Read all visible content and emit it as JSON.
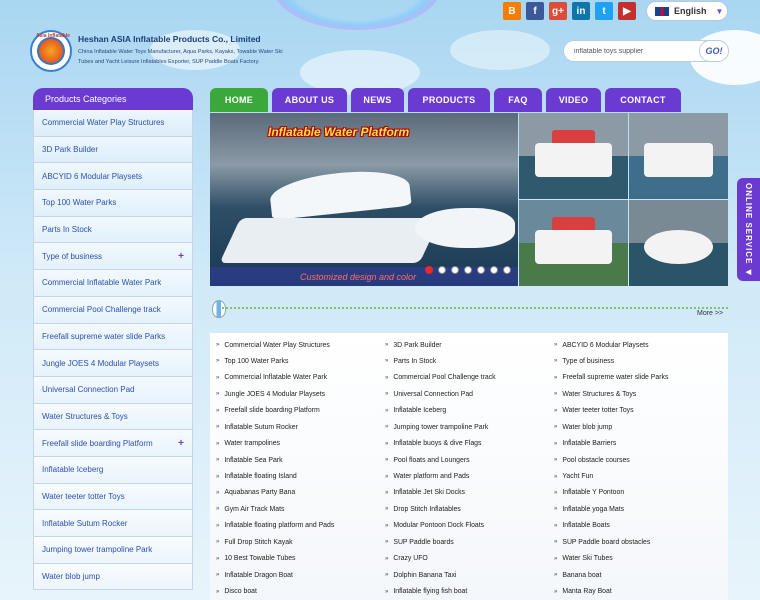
{
  "header": {
    "logo_tag": "Asia Inflatable",
    "company_name": "Heshan ASIA Inflatable Products Co., Limited",
    "company_sub": "China Inflatable Water Toys Manufacturer, Aqua Parks, Kayaks, Towable Water Ski Tubes and Yacht Leisure Inflatables Exporter, SUP Paddle Boats Factory.",
    "social": [
      {
        "name": "blogger-icon",
        "glyph": "B",
        "color": "#f57d00"
      },
      {
        "name": "facebook-icon",
        "glyph": "f",
        "color": "#3b5998"
      },
      {
        "name": "google-plus-icon",
        "glyph": "g+",
        "color": "#dd4b39"
      },
      {
        "name": "linkedin-icon",
        "glyph": "in",
        "color": "#0e76a8"
      },
      {
        "name": "twitter-icon",
        "glyph": "t",
        "color": "#1da1f2"
      },
      {
        "name": "youtube-icon",
        "glyph": "▶",
        "color": "#c4302b"
      }
    ],
    "language": "English",
    "search_value": "inflatable toys supplier",
    "search_button": "GO!"
  },
  "sidebar": {
    "title": "Products Categories",
    "items": [
      {
        "label": "Commercial Water Play Structures",
        "expand": ""
      },
      {
        "label": "3D Park Builder",
        "expand": ""
      },
      {
        "label": "ABCYID 6 Modular Playsets",
        "expand": ""
      },
      {
        "label": "Top 100 Water Parks",
        "expand": ""
      },
      {
        "label": "Parts In Stock",
        "expand": ""
      },
      {
        "label": "Type of business",
        "expand": "+"
      },
      {
        "label": "Commercial Inflatable Water Park",
        "expand": ""
      },
      {
        "label": "Commercial Pool Challenge track",
        "expand": ""
      },
      {
        "label": "Freefall supreme water slide Parks",
        "expand": ""
      },
      {
        "label": "Jungle JOES 4 Modular Playsets",
        "expand": ""
      },
      {
        "label": "Universal Connection Pad",
        "expand": ""
      },
      {
        "label": "Water Structures & Toys",
        "expand": ""
      },
      {
        "label": "Freefall slide boarding Platform",
        "expand": "+"
      },
      {
        "label": "Inflatable Iceberg",
        "expand": ""
      },
      {
        "label": "Water teeter totter Toys",
        "expand": ""
      },
      {
        "label": "Inflatable Sutum Rocker",
        "expand": ""
      },
      {
        "label": "Jumping tower trampoline Park",
        "expand": ""
      },
      {
        "label": "Water blob jump",
        "expand": ""
      }
    ]
  },
  "nav": [
    {
      "label": "HOME",
      "active": true,
      "width": 58
    },
    {
      "label": "ABOUT US",
      "active": false,
      "width": 75
    },
    {
      "label": "NEWS",
      "active": false,
      "width": 53
    },
    {
      "label": "PRODUCTS",
      "active": false,
      "width": 82
    },
    {
      "label": "FAQ",
      "active": false,
      "width": 48
    },
    {
      "label": "VIDEO",
      "active": false,
      "width": 55
    },
    {
      "label": "CONTACT",
      "active": false,
      "width": 76
    }
  ],
  "banner": {
    "title": "Inflatable Water Platform",
    "caption": "Customized design and color",
    "slide_count": 7,
    "active_slide": 1
  },
  "online_service": "ONLINE SERVICE",
  "more_label": "More >>",
  "links": [
    "Commercial Water Play Structures",
    "3D Park Builder",
    "ABCYID 6 Modular Playsets",
    "Top 100 Water Parks",
    "Parts In Stock",
    "Type of business",
    "Commercial Inflatable Water Park",
    "Commercial Pool Challenge track",
    "Freefall supreme water slide Parks",
    "Jungle JOES 4 Modular Playsets",
    "Universal Connection Pad",
    "Water Structures & Toys",
    "Freefall slide boarding Platform",
    "Inflatable Iceberg",
    "Water teeter totter Toys",
    "Inflatable Sutum Rocker",
    "Jumping tower trampoline Park",
    "Water blob jump",
    "Water trampolines",
    "Inflatable buoys & dive Flags",
    "Inflatable Barriers",
    "Inflatable Sea Park",
    "Pool floats and Loungers",
    "Pool obstacle courses",
    "Inflatable floating Island",
    "Water platform and Pads",
    "Yacht Fun",
    "Aquabanas Party Bana",
    "Inflatable Jet Ski Docks",
    "Inflatable Y Pontoon",
    "Gym Air Track Mats",
    "Drop Stitch Inflatables",
    "Inflatable yoga Mats",
    "Inflatable floating platform and Pads",
    "Modular Pontoon Dock Floats",
    "Inflatable Boats",
    "Full Drop Stitch Kayak",
    "SUP Paddle boards",
    "SUP Paddle board obstacles",
    "10 Best Towable Tubes",
    "Crazy UFO",
    "Water Ski Tubes",
    "Inflatable Dragon Boat",
    "Dolphin Banana Taxi",
    "Banana boat",
    "Disco boat",
    "Inflatable flying fish boat",
    "Manta Ray Boat"
  ]
}
